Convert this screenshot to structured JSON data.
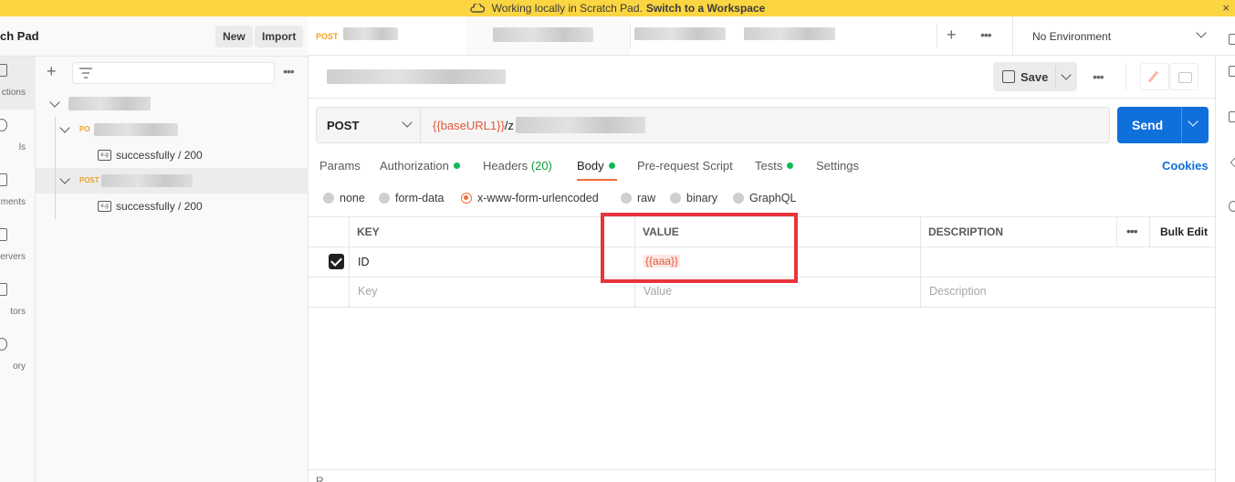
{
  "banner": {
    "text": "Working locally in Scratch Pad.",
    "link": "Switch to a Workspace",
    "close": "×"
  },
  "workspace": {
    "title": "ch Pad",
    "new_label": "New",
    "import_label": "Import"
  },
  "rail": {
    "items": [
      {
        "label": "ctions",
        "icon": "collections-icon",
        "active": true
      },
      {
        "label": "ls",
        "icon": "apis-icon"
      },
      {
        "label": "ments",
        "icon": "environments-icon"
      },
      {
        "label": "ervers",
        "icon": "mock-servers-icon"
      },
      {
        "label": "tors",
        "icon": "monitors-icon"
      },
      {
        "label": "ory",
        "icon": "history-icon"
      }
    ]
  },
  "sidebar": {
    "more": "•••",
    "tree": {
      "requests": [
        {
          "method": "PO",
          "example": "successfully / 200"
        },
        {
          "method": "POST",
          "example": "successfully / 200"
        }
      ],
      "example_icon_text": "e.g"
    }
  },
  "tabs": {
    "items": [
      {
        "method": "POST"
      }
    ],
    "plus": "+",
    "more": "•••",
    "environment": "No Environment"
  },
  "request": {
    "save_label": "Save",
    "more": "•••",
    "method": "POST",
    "url_var": "{{baseURL1}}",
    "url_rest": "/z",
    "send_label": "Send",
    "tabs": {
      "params": "Params",
      "authorization": "Authorization",
      "headers": "Headers",
      "headers_count": "(20)",
      "body": "Body",
      "prerequest": "Pre-request Script",
      "tests": "Tests",
      "settings": "Settings"
    },
    "cookies": "Cookies",
    "body_types": [
      "none",
      "form-data",
      "x-www-form-urlencoded",
      "raw",
      "binary",
      "GraphQL"
    ],
    "body_type_selected": "x-www-form-urlencoded"
  },
  "table": {
    "headers": {
      "key": "KEY",
      "value": "VALUE",
      "description": "DESCRIPTION",
      "more": "•••",
      "bulk_edit": "Bulk Edit"
    },
    "rows": [
      {
        "checked": true,
        "key": "ID",
        "value": "{{aaa}}",
        "description": ""
      }
    ],
    "placeholder": {
      "key": "Key",
      "value": "Value",
      "description": "Description"
    }
  },
  "colors": {
    "accent_orange": "#f26b3a",
    "send_blue": "#0f6fdb",
    "banner_yellow": "#fbd542",
    "highlight_red": "#e8353b",
    "variable_red": "#e5583a"
  },
  "response": {
    "label": "R"
  }
}
